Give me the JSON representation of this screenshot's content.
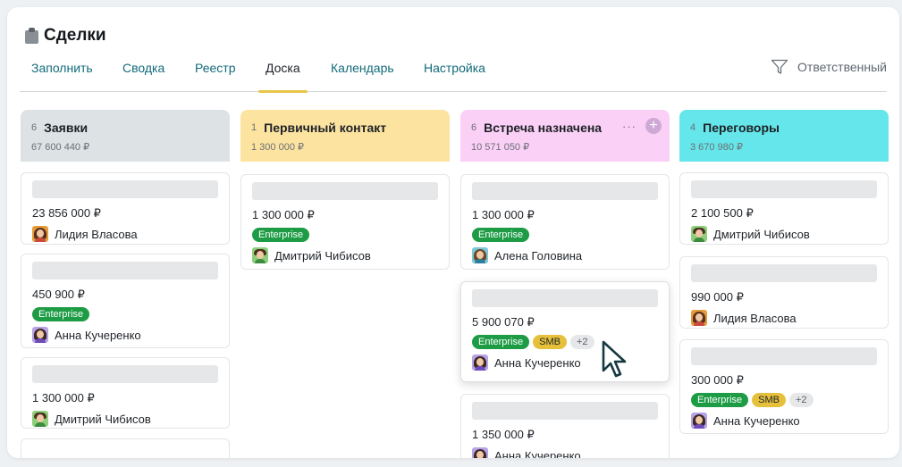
{
  "page": {
    "title": "Сделки",
    "title_icon": "clipboard-icon"
  },
  "tabs": [
    {
      "label": "Заполнить"
    },
    {
      "label": "Сводка"
    },
    {
      "label": "Реестр"
    },
    {
      "label": "Доска",
      "active": true
    },
    {
      "label": "Календарь"
    },
    {
      "label": "Настройка"
    }
  ],
  "filter": {
    "label": "Ответственный",
    "icon": "filter-icon"
  },
  "colors": {
    "col_requests": "#dde2e5",
    "col_first_contact": "#fde3a0",
    "col_meeting": "#fbd0f7",
    "col_negotiation": "#65e6ea",
    "tag_enterprise": "#1d9c45",
    "tag_smb": "#e6c03b",
    "link": "#126b7a",
    "tab_underline": "#e8c547"
  },
  "columns": [
    {
      "count": "6",
      "name": "Заявки",
      "sum": "67 600 440 ₽",
      "cards": [
        {
          "amount": "23 856 000 ₽",
          "person": "Лидия Власова"
        },
        {
          "amount": "450 900 ₽",
          "tags": [
            "Enterprise"
          ],
          "person": "Анна Кучеренко"
        },
        {
          "amount": "1 300 000 ₽",
          "person": "Дмитрий Чибисов"
        }
      ]
    },
    {
      "count": "1",
      "name": "Первичный контакт",
      "sum": "1 300 000 ₽",
      "cards": [
        {
          "amount": "1 300 000 ₽",
          "tags": [
            "Enterprise"
          ],
          "person": "Дмитрий Чибисов"
        }
      ]
    },
    {
      "count": "6",
      "name": "Встреча назначена",
      "sum": "10 571 050 ₽",
      "actions": {
        "more": "···",
        "add": "+"
      },
      "cards": [
        {
          "amount": "1 300 000 ₽",
          "tags": [
            "Enterprise"
          ],
          "person": "Алена Головина"
        },
        {
          "amount": "5 900 070 ₽",
          "tags": [
            "Enterprise",
            "SMB",
            "+2"
          ],
          "person": "Анна Кучеренко"
        },
        {
          "amount": "1 350 000 ₽",
          "person": "Анна Кучеренко"
        }
      ]
    },
    {
      "count": "4",
      "name": "Переговоры",
      "sum": "3 670 980 ₽",
      "cards": [
        {
          "amount": "2 100 500 ₽",
          "person": "Дмитрий Чибисов"
        },
        {
          "amount": "990 000 ₽",
          "person": "Лидия Власова"
        },
        {
          "amount": "300 000 ₽",
          "tags": [
            "Enterprise",
            "SMB",
            "+2"
          ],
          "person": "Анна Кучеренко"
        }
      ]
    }
  ]
}
